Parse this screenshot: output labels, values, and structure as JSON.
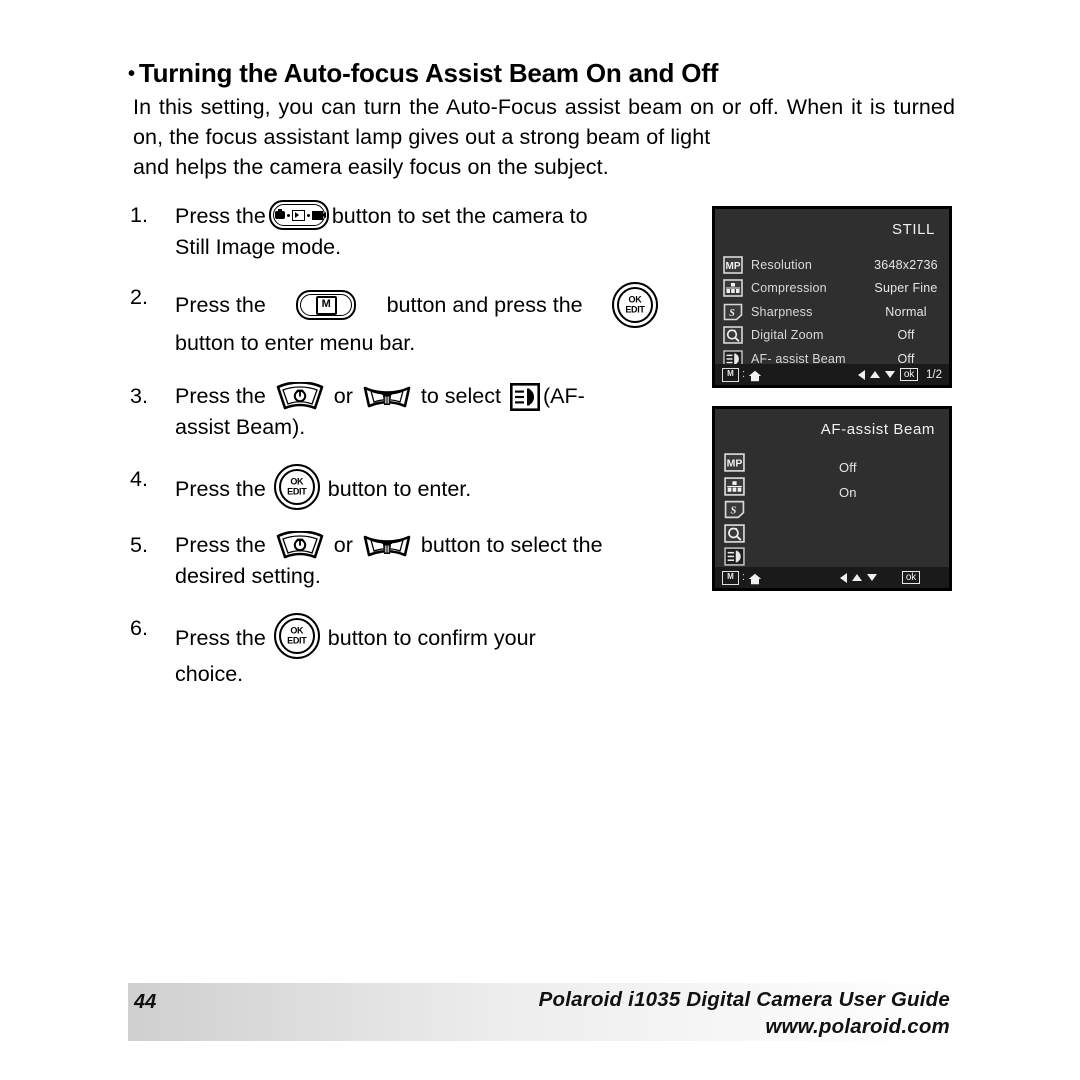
{
  "heading": {
    "bullet": "•",
    "text": "Turning the Auto-focus Assist Beam On and Off"
  },
  "intro": {
    "line1": "In this setting, you can turn the Auto-Focus assist beam on or off. When",
    "line2": "it is turned on, the focus assistant lamp gives out a strong beam of light",
    "line3": "and helps the camera easily focus on the subject."
  },
  "steps": [
    {
      "num": "1.",
      "before": "Press the",
      "icon": "mode-button",
      "after": "button to set the camera to",
      "line2": "Still Image mode."
    },
    {
      "num": "2.",
      "before": "Press the",
      "icon": "menu-button",
      "mid": "button and press the",
      "icon2": "ok-edit-button",
      "line2": "button to enter menu bar."
    },
    {
      "num": "3.",
      "before": "Press the",
      "icon": "up-self-timer-button",
      "mid": "or",
      "icon2": "down-delete-button",
      "after": "to select",
      "icon3": "af-assist-beam-icon",
      "tail": "(AF-",
      "line2": "assist Beam)."
    },
    {
      "num": "4.",
      "before": "Press the",
      "icon": "ok-edit-button",
      "after": "button to enter."
    },
    {
      "num": "5.",
      "before": "Press the",
      "icon": "up-self-timer-button",
      "mid": "or",
      "icon2": "down-delete-button",
      "after": "button to select the",
      "line2": "desired setting."
    },
    {
      "num": "6.",
      "before": "Press  the",
      "icon": "ok-edit-button",
      "after": "button  to  confirm  your",
      "line2": "choice."
    }
  ],
  "button_labels": {
    "ok_line1": "OK",
    "ok_line2": "EDIT",
    "menu_letter": "M"
  },
  "lcd_menu": {
    "title": "STILL",
    "rows": [
      {
        "icon": "resolution-mp-icon",
        "label": "Resolution",
        "value": "3648x2736"
      },
      {
        "icon": "compression-icon",
        "label": "Compression",
        "value": "Super Fine"
      },
      {
        "icon": "sharpness-icon",
        "label": "Sharpness",
        "value": "Normal"
      },
      {
        "icon": "digital-zoom-icon",
        "label": "Digital Zoom",
        "value": "Off"
      },
      {
        "icon": "af-assist-beam-icon",
        "label": "AF- assist Beam",
        "value": "Off"
      }
    ],
    "bar": {
      "menu_letter": "M",
      "separator": ":",
      "home": "home-icon",
      "ok": "ok",
      "page": "1/2"
    }
  },
  "lcd_option": {
    "title": "AF-assist Beam",
    "rail_icons": [
      "resolution-mp-icon",
      "compression-icon",
      "sharpness-icon",
      "digital-zoom-icon",
      "af-assist-beam-icon"
    ],
    "options": [
      "Off",
      "On"
    ],
    "bar": {
      "menu_letter": "M",
      "separator": ":",
      "home": "home-icon",
      "ok": "ok"
    }
  },
  "footer": {
    "page_number": "44",
    "title": "Polaroid i1035 Digital Camera User Guide",
    "url": "www.polaroid.com"
  },
  "colors": {
    "lcd_background": "#2f2f2f",
    "lcd_bar": "#1a1a1a",
    "text": "#000000",
    "lcd_text": "#e8e8e8"
  }
}
